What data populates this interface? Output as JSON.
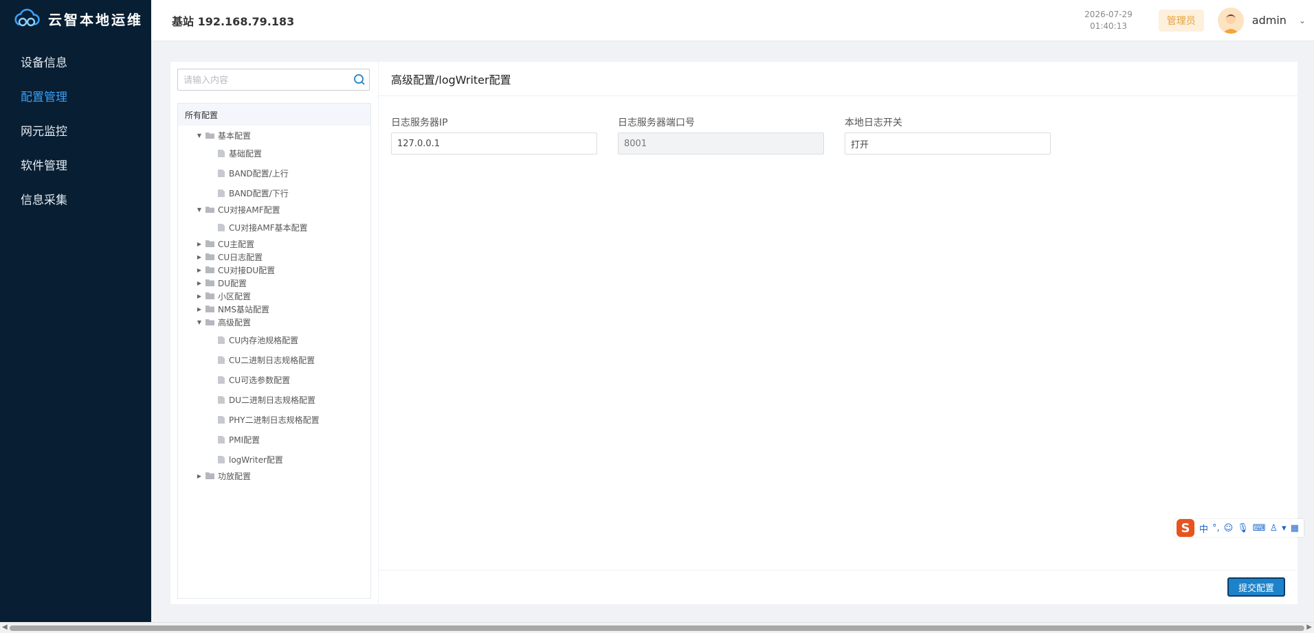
{
  "app": {
    "title": "云智本地运维"
  },
  "sidebar": {
    "items": [
      {
        "label": "设备信息",
        "active": false
      },
      {
        "label": "配置管理",
        "active": true
      },
      {
        "label": "网元监控",
        "active": false
      },
      {
        "label": "软件管理",
        "active": false
      },
      {
        "label": "信息采集",
        "active": false
      }
    ]
  },
  "header": {
    "station": "基站 192.168.79.183",
    "date": "2026-07-29",
    "time": "01:40:13",
    "role": "管理员",
    "username": "admin"
  },
  "search": {
    "placeholder": "请输入内容"
  },
  "tree": {
    "root": "所有配置",
    "nodes": [
      {
        "label": "基本配置",
        "type": "folder",
        "expanded": true
      },
      {
        "label": "基础配置",
        "type": "file"
      },
      {
        "label": "BAND配置/上行",
        "type": "file"
      },
      {
        "label": "BAND配置/下行",
        "type": "file"
      },
      {
        "label": "CU对接AMF配置",
        "type": "folder",
        "expanded": true
      },
      {
        "label": "CU对接AMF基本配置",
        "type": "file"
      },
      {
        "label": "CU主配置",
        "type": "folder",
        "expanded": false
      },
      {
        "label": "CU日志配置",
        "type": "folder",
        "expanded": false
      },
      {
        "label": "CU对接DU配置",
        "type": "folder",
        "expanded": false
      },
      {
        "label": "DU配置",
        "type": "folder",
        "expanded": false
      },
      {
        "label": "小区配置",
        "type": "folder",
        "expanded": false
      },
      {
        "label": "NMS基站配置",
        "type": "folder",
        "expanded": false
      },
      {
        "label": "高级配置",
        "type": "folder",
        "expanded": true
      },
      {
        "label": "CU内存池规格配置",
        "type": "file"
      },
      {
        "label": "CU二进制日志规格配置",
        "type": "file"
      },
      {
        "label": "CU可选参数配置",
        "type": "file"
      },
      {
        "label": "DU二进制日志规格配置",
        "type": "file"
      },
      {
        "label": "PHY二进制日志规格配置",
        "type": "file"
      },
      {
        "label": "PMI配置",
        "type": "file"
      },
      {
        "label": "logWriter配置",
        "type": "file",
        "selected": true
      },
      {
        "label": "功放配置",
        "type": "folder",
        "expanded": false
      }
    ]
  },
  "content": {
    "title": "高级配置/logWriter配置",
    "fields": [
      {
        "label": "日志服务器IP",
        "value": "127.0.0.1",
        "disabled": false
      },
      {
        "label": "日志服务器端口号",
        "value": "8001",
        "disabled": true
      },
      {
        "label": "本地日志开关",
        "value": "打开",
        "disabled": false
      }
    ],
    "submit_label": "提交配置"
  },
  "ime": {
    "mode": "中",
    "logo": "S"
  },
  "colors": {
    "sidebar_bg": "#071e33",
    "accent": "#3aa0f5",
    "submit_bg": "#1d82c9",
    "role_badge": "#e6a23c"
  }
}
